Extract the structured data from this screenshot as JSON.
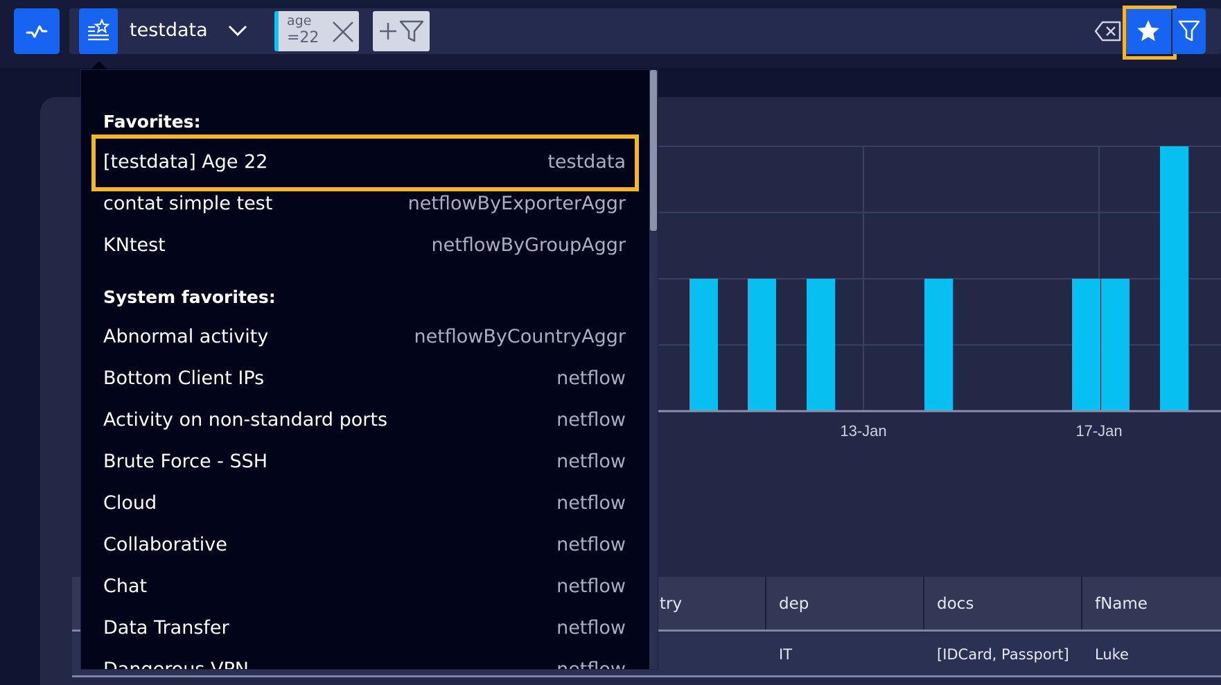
{
  "toolbar": {
    "brand_icon": "activity-pulse-icon",
    "saved_searches_icon": "favorites-list-icon",
    "index_name": "testdata",
    "filter_pill": {
      "line1": "age",
      "line2": "=22"
    },
    "clear_icon": "clear-backspace-icon",
    "favorite_icon": "star-icon",
    "filter_icon": "filter-funnel-icon"
  },
  "dropdown": {
    "favorites_title": "Favorites:",
    "favorites": [
      {
        "name": "[testdata] Age 22",
        "source": "testdata"
      },
      {
        "name": "contat simple test",
        "source": "netflowByExporterAggr"
      },
      {
        "name": "KNtest",
        "source": "netflowByGroupAggr"
      }
    ],
    "system_title": "System favorites:",
    "system": [
      {
        "name": "Abnormal activity",
        "source": "netflowByCountryAggr"
      },
      {
        "name": "Bottom Client IPs",
        "source": "netflow"
      },
      {
        "name": "Activity on non-standard ports",
        "source": "netflow"
      },
      {
        "name": "Brute Force - SSH",
        "source": "netflow"
      },
      {
        "name": "Cloud",
        "source": "netflow"
      },
      {
        "name": "Collaborative",
        "source": "netflow"
      },
      {
        "name": "Chat",
        "source": "netflow"
      },
      {
        "name": "Data Transfer",
        "source": "netflow"
      },
      {
        "name": "Dangerous VPN",
        "source": "netflow"
      }
    ]
  },
  "chart_data": {
    "type": "bar",
    "x_ticks": [
      "13-Jan",
      "17-Jan"
    ],
    "values": [
      2,
      2,
      2,
      2,
      2,
      2,
      4
    ],
    "bar_color": "#07bff0",
    "grid": true
  },
  "table": {
    "columns": [
      "try",
      "dep",
      "docs",
      "fName"
    ],
    "rows": [
      [
        "",
        "IT",
        "[IDCard, Passport]",
        "Luke"
      ]
    ]
  },
  "colors": {
    "accent": "#1763f2",
    "highlight": "#f6b52f",
    "bar": "#07bff0"
  }
}
